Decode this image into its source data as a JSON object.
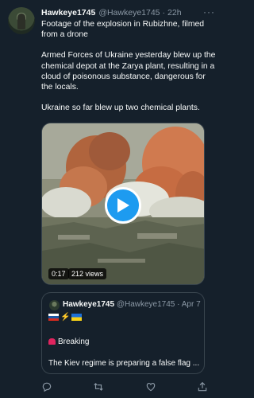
{
  "tweet": {
    "name": "Hawkeye1745",
    "handle": "@Hawkeye1745",
    "separator": "·",
    "time": "22h",
    "more": "···",
    "paragraphs": [
      "Footage of the explosion in Rubizhne, filmed from a drone",
      "Armed Forces of Ukraine yesterday blew up the chemical depot at the Zarya plant, resulting in a cloud of poisonous substance, dangerous for the locals.",
      "Ukraine so far blew up two chemical plants."
    ]
  },
  "media": {
    "duration": "0:17",
    "views": "212 views",
    "play_icon": "play-icon"
  },
  "quote": {
    "name": "Hawkeye1745",
    "handle": "@Hawkeye1745",
    "separator": "·",
    "time": "Apr 7",
    "breaking": "Breaking",
    "text": "The Kiev regime is preparing a false flag ..."
  },
  "actions": [
    "reply-icon",
    "retweet-icon",
    "like-icon",
    "share-icon"
  ],
  "colors": {
    "background": "#15202b",
    "text": "#f7f9f9",
    "muted": "#8b98a5",
    "accent": "#1d9bf0",
    "border": "#38444d"
  }
}
